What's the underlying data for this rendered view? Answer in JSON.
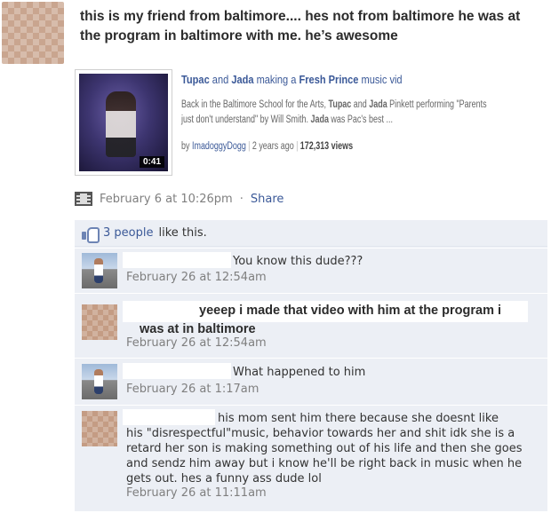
{
  "post": {
    "text": "this is my friend from baltimore.... hes not from baltimore he was at the program in baltimore with me. he’s awesome",
    "timestamp": "February 6 at 10:26pm",
    "separator": "·",
    "share_label": "Share"
  },
  "attachment": {
    "title_parts": [
      "Tupac",
      " and ",
      "Jada",
      " making a ",
      "Fresh Prince",
      " music vid"
    ],
    "description_parts": [
      "Back in the Baltimore School for the Arts, ",
      "Tupac",
      " and ",
      "Jada",
      " Pinkett performing \"Parents just don't understand\" by Will Smith. ",
      "Jada",
      " was Pac's best ..."
    ],
    "by_label": "by",
    "uploader": "ImadoggyDogg",
    "age": "2 years ago",
    "views": "172,313 views",
    "duration": "0:41"
  },
  "likes": {
    "count_text": "3 people",
    "suffix": "like this."
  },
  "comments": [
    {
      "text": "You know this dude???",
      "time": "February 26 at 12:54am",
      "avatar": "photo"
    },
    {
      "text": "yeeep i made that video with him at the program i",
      "text2": "was at in baltimore",
      "time": "February 26 at 12:54am",
      "avatar": "blur"
    },
    {
      "text": "What happened to him",
      "time": "February 26 at 1:17am",
      "avatar": "photo"
    },
    {
      "text": "his mom sent him there because she doesnt like",
      "text2": "his \"disrespectful\"music, behavior towards her and shit idk she is a retard her son is making something out of his life and then she goes and sendz him away but i know he'll be right back in music when he gets out. hes a funny ass dude lol",
      "time": "February 26 at 11:11am",
      "avatar": "blur"
    }
  ]
}
